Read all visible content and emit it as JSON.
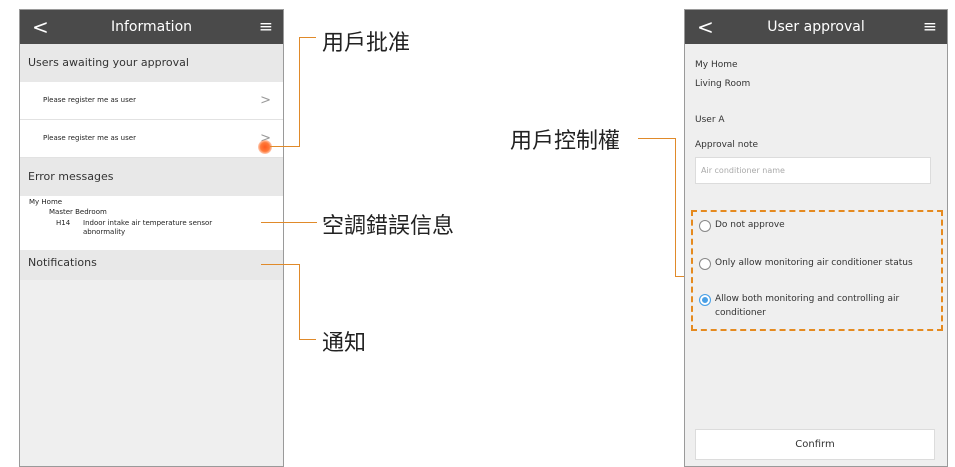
{
  "left_screen": {
    "title": "Information",
    "back_glyph": "<",
    "menu_glyph": "≡",
    "awaiting_header": "Users awaiting your approval",
    "requests": [
      {
        "label": "Please register me as user",
        "chevron": ">"
      },
      {
        "label": "Please register me as user",
        "chevron": ">"
      }
    ],
    "error_header": "Error messages",
    "error": {
      "home": "My Home",
      "room": "Master Bedroom",
      "code": "H14",
      "message_line1": "Indoor intake air temperature sensor",
      "message_line2": "abnormality"
    },
    "notifications_header": "Notifications"
  },
  "callouts": {
    "user_approval": "用戶批准",
    "ac_error": "空調錯誤信息",
    "notification": "通知",
    "user_control": "用戶控制權"
  },
  "right_screen": {
    "title": "User approval",
    "back_glyph": "<",
    "menu_glyph": "≡",
    "home": "My Home",
    "room": "Living Room",
    "user": "User A",
    "approval_note_label": "Approval note",
    "approval_note_placeholder": "Air conditioner name",
    "options": [
      {
        "label": "Do not approve",
        "selected": false
      },
      {
        "label": "Only allow monitoring air conditioner status",
        "selected": false
      },
      {
        "label_line1": "Allow both monitoring and controlling air",
        "label_line2": "conditioner",
        "selected": true
      }
    ],
    "confirm_label": "Confirm"
  },
  "colors": {
    "topbar": "#4a4a4a",
    "callout_line": "#e08a2a",
    "selected_radio": "#4aa0e6"
  }
}
